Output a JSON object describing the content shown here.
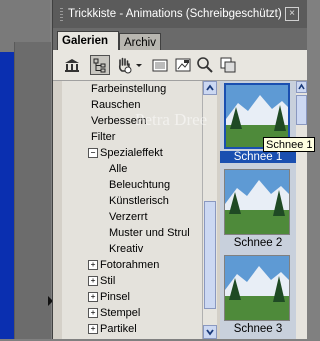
{
  "window": {
    "title": "Trickkiste - Animations (Schreibgeschützt)",
    "close_symbol": "×"
  },
  "tabs": [
    {
      "label": "Galerien",
      "active": true
    },
    {
      "label": "Archiv",
      "active": false
    }
  ],
  "toolbar": {
    "icons": [
      "gallery-icon",
      "tree-view-icon",
      "hand-icon",
      "dropdown-arrow-icon",
      "image-icon",
      "photo-frame-icon",
      "search-icon",
      "copy-icon"
    ]
  },
  "tree": {
    "items": [
      {
        "label": "Farbeinstellung",
        "level": 1
      },
      {
        "label": "Rauschen",
        "level": 1
      },
      {
        "label": "Verbessern",
        "level": 1
      },
      {
        "label": "Filter",
        "level": 1
      },
      {
        "label": "Spezialeffekt",
        "level": 0,
        "toggle": "−"
      },
      {
        "label": "Alle",
        "level": 1
      },
      {
        "label": "Beleuchtung",
        "level": 1
      },
      {
        "label": "Künstlerisch",
        "level": 1
      },
      {
        "label": "Verzerrt",
        "level": 1
      },
      {
        "label": "Muster und Strul",
        "level": 1
      },
      {
        "label": "Kreativ",
        "level": 1
      },
      {
        "label": "Fotorahmen",
        "level": 0,
        "toggle": "+"
      },
      {
        "label": "Stil",
        "level": 0,
        "toggle": "+"
      },
      {
        "label": "Pinsel",
        "level": 0,
        "toggle": "+"
      },
      {
        "label": "Stempel",
        "level": 0,
        "toggle": "+"
      },
      {
        "label": "Partikel",
        "level": 0,
        "toggle": "+"
      }
    ]
  },
  "thumbnails": [
    {
      "label": "Schnee 1",
      "selected": true
    },
    {
      "label": "Schnee 2",
      "selected": false
    },
    {
      "label": "Schnee 3",
      "selected": false
    }
  ],
  "tooltip": {
    "text": "Schnee 1"
  },
  "watermark": {
    "text": "Petra Dree"
  },
  "colors": {
    "selection": "#1a4fb0",
    "titlebar": "#5b5b5b",
    "scrollbar": "#ccd8f2"
  }
}
